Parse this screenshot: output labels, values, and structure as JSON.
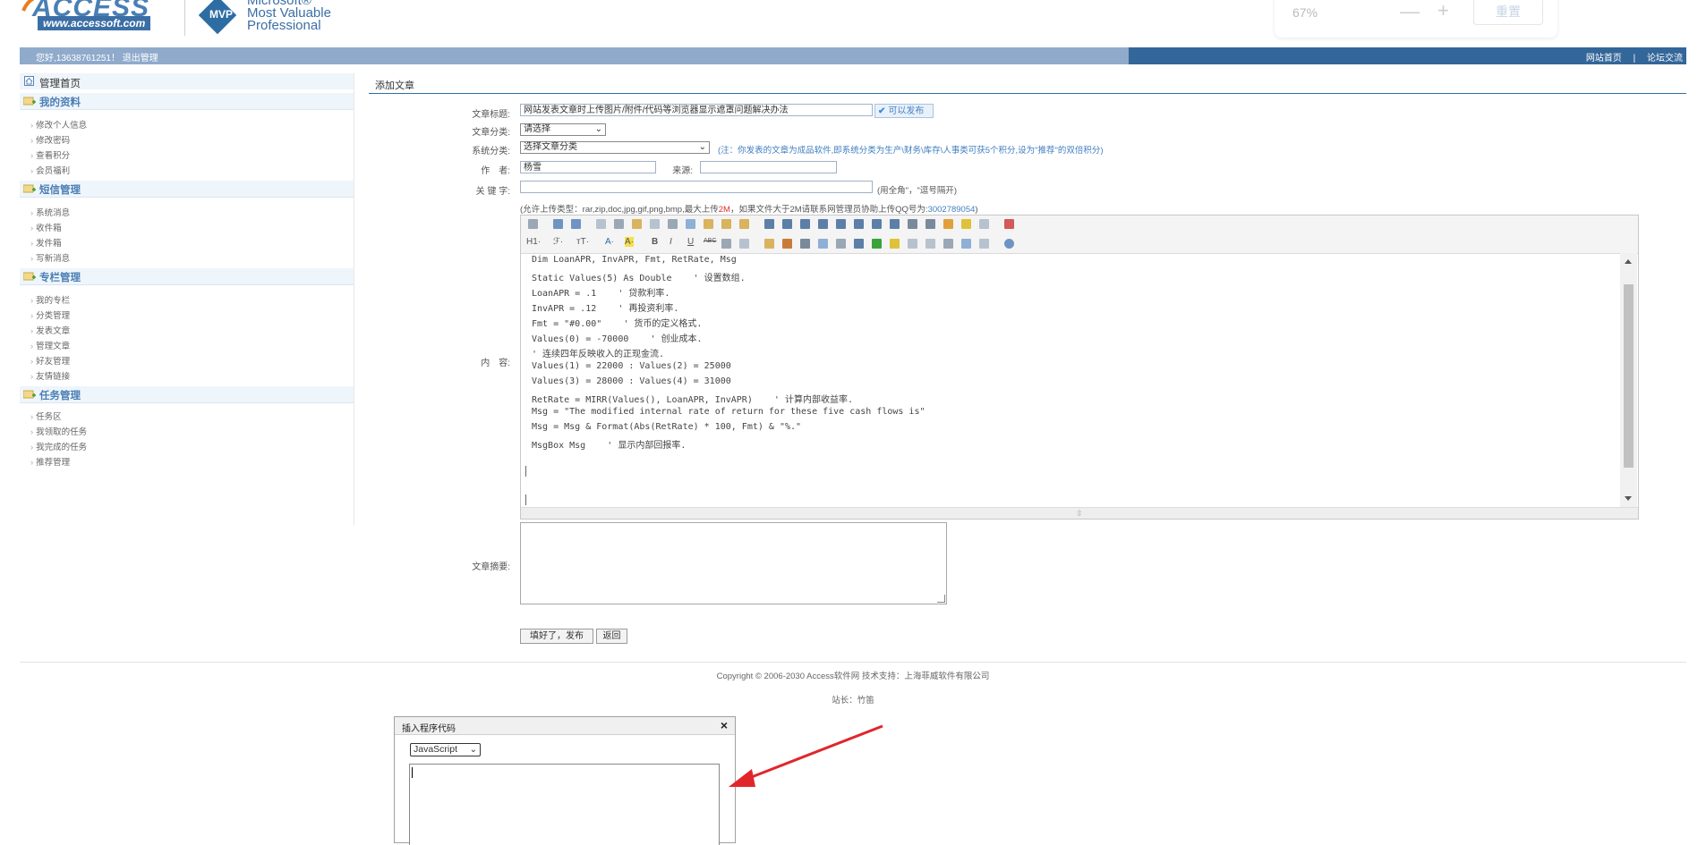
{
  "header": {
    "logo_word": "ACCESS",
    "logo_url": "www.accessoft.com",
    "mvp_badge": "MVP",
    "mvp_line1": "Microsoft®",
    "mvp_line2": "Most Valuable",
    "mvp_line3": "Professional",
    "zoom_level": "67%",
    "zoom_minus": "—",
    "zoom_plus": "+",
    "zoom_reset": "重置"
  },
  "topbar": {
    "greeting": "您好,13638761251！ 退出管理",
    "link_home": "网站首页",
    "separator": "|",
    "link_forum": "论坛交流"
  },
  "sidebar": {
    "home": "管理首页",
    "sections": [
      {
        "title": "我的资料",
        "items": [
          "修改个人信息",
          "修改密码",
          "查看积分",
          "会员福利"
        ]
      },
      {
        "title": "短信管理",
        "items": [
          "系统消息",
          "收件箱",
          "发件箱",
          "写新消息"
        ]
      },
      {
        "title": "专栏管理",
        "items": [
          "我的专栏",
          "分类管理",
          "发表文章",
          "管理文章",
          "好友管理",
          "友情链接"
        ]
      },
      {
        "title": "任务管理",
        "items": [
          "任务区",
          "我领取的任务",
          "我完成的任务",
          "推荐管理"
        ]
      }
    ]
  },
  "form": {
    "page_title": "添加文章",
    "title_label": "文章标题:",
    "title_value": "网站发表文章时上传图片/附件/代码等浏览器显示遮罩问题解决办法",
    "publish_ok": "可以发布",
    "category_label": "文章分类:",
    "category_value": "请选择",
    "system_label": "系统分类:",
    "system_value": "选择文章分类",
    "system_note": "(注：你发表的文章为成品软件,即系统分类为生产\\财务\\库存\\人事类可获5个积分,设为\"推荐\"的双倍积分)",
    "author_label": "作　者:",
    "author_value": "杨雪",
    "source_label": "来源:",
    "source_value": "",
    "keyword_label": "关 键 字:",
    "keyword_value": "",
    "keyword_note": "(用全角\"，\"逗号隔开)",
    "upload_note_pre": "(允许上传类型：rar,zip,doc,jpg,gif,png,bmp,最大上传",
    "upload_note_size": "2M",
    "upload_note_mid": "，如果文件大于2M请联系网管理员协助上传QQ号为:",
    "upload_note_qq": "3002789054",
    "upload_note_end": ")",
    "content_label": "内　容:",
    "toolbar_h": "H1·",
    "toolbar_font": "ℱ·",
    "toolbar_size": "тT·",
    "toolbar_color": "A·",
    "toolbar_bg": "A·",
    "toolbar_bold": "B",
    "toolbar_italic": "I",
    "toolbar_underline": "U",
    "toolbar_strike": "ABC",
    "code_lines": [
      "Dim LoanAPR, InvAPR, Fmt, RetRate, Msg",
      "Static Values(5) As Double    ' 设置数组.",
      "LoanAPR = .1    ' 贷款利率.",
      "InvAPR = .12    ' 再投资利率.",
      "Fmt = \"#0.00\"    ' 货币的定义格式.",
      "Values(0) = -70000    ' 创业成本.",
      "' 连续四年反映收入的正现金流.",
      "Values(1) = 22000 : Values(2) = 25000",
      "Values(3) = 28000 : Values(4) = 31000",
      "RetRate = MIRR(Values(), LoanAPR, InvAPR)    ' 计算内部收益率.",
      "Msg = \"The modified internal rate of return for these five cash flows is\"",
      "Msg = Msg & Format(Abs(RetRate) * 100, Fmt) & \"%.\"",
      "MsgBox Msg    ' 显示内部回报率."
    ],
    "summary_label": "文章摘要:",
    "submit_label": "填好了，发布",
    "back_label": "返回"
  },
  "footer": {
    "copyright": "Copyright © 2006-2030 Access软件网 技术支持：上海菲威软件有限公司",
    "master": "站长：竹笛"
  },
  "dialog": {
    "title": "插入程序代码",
    "close": "×",
    "language": "JavaScript"
  },
  "colors": {
    "topbar": "#8faacb",
    "topbar_dark": "#336699",
    "accent": "#2f6ea3",
    "arrow": "#e0262b"
  }
}
